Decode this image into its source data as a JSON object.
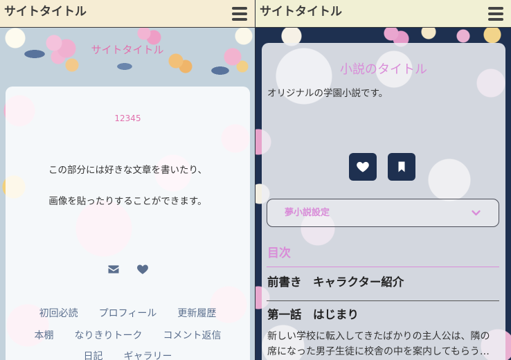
{
  "colors": {
    "left_header_bg": "#f6edd4",
    "right_header_bg": "#f1f0d4",
    "accent_pink": "#e271ad",
    "accent_orchid": "#d98cd8",
    "navy": "#1e3050",
    "link_slate": "#5b6f8e"
  },
  "left": {
    "header": {
      "title": "サイトタイトル",
      "menu_icon": "hamburger-icon"
    },
    "site_title": "サイトタイトル",
    "card": {
      "counter": "12345",
      "text_lines": [
        "この部分には好きな文章を書いたり、",
        "画像を貼ったりすることができます。"
      ],
      "icons": [
        "envelope-icon",
        "heart-icon"
      ],
      "nav_rows": [
        [
          "初回必読",
          "プロフィール",
          "更新履歴"
        ],
        [
          "本棚",
          "なりきりトーク",
          "コメント返信"
        ],
        [
          "日記",
          "ギャラリー"
        ]
      ]
    }
  },
  "right": {
    "header": {
      "title": "サイトタイトル",
      "menu_icon": "hamburger-icon"
    },
    "novel": {
      "title": "小説のタイトル",
      "description": "オリジナルの学園小説です。",
      "action_icons": [
        "heart-icon",
        "bookmark-icon"
      ],
      "settings": {
        "label": "夢小説設定",
        "icon": "chevron-down-icon"
      },
      "toc_heading": "目次",
      "chapters": [
        {
          "title": "前書き　キャラクター紹介"
        },
        {
          "title": "第一話　はじまり",
          "summary_lines": [
            "新しい学校に転入してきたばかりの主人公は、隣の",
            "席になった男子生徒に校舎の中を案内してもらう…"
          ]
        }
      ]
    }
  }
}
